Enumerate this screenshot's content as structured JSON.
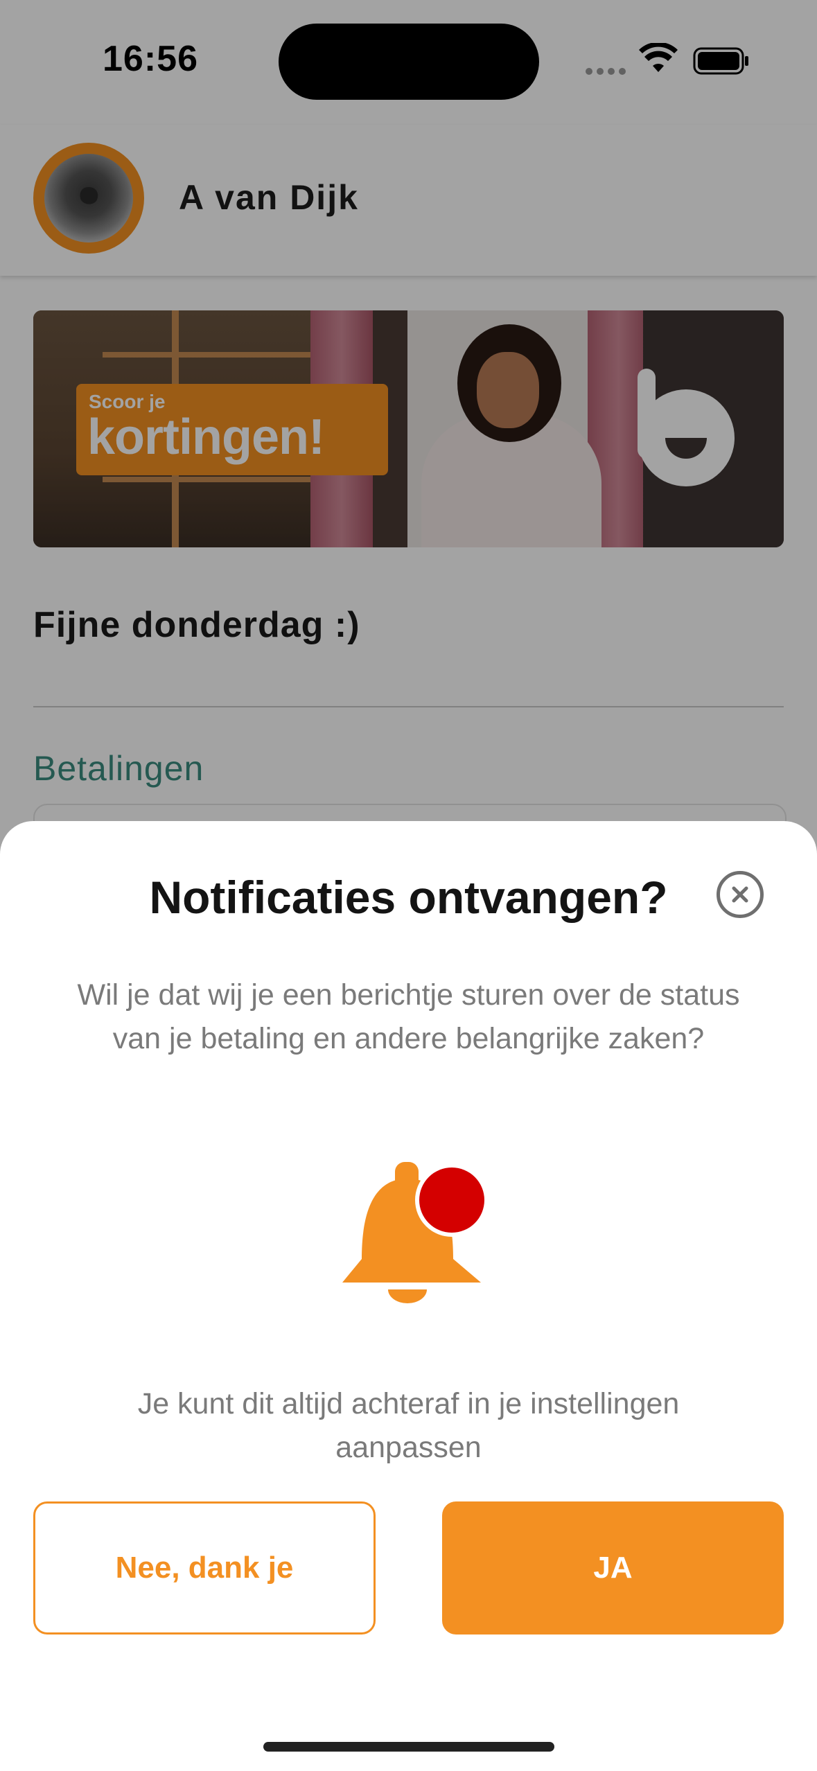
{
  "status_bar": {
    "time": "16:56"
  },
  "header": {
    "user_name": "A van Dijk"
  },
  "banner": {
    "tag_small": "Scoor je",
    "tag_big": "kortingen!"
  },
  "greeting": "Fijne donderdag :)",
  "section": {
    "title": "Betalingen"
  },
  "sheet": {
    "title": "Notificaties ontvangen?",
    "body": "Wil je dat wij je een berichtje sturen over de status van je betaling en andere belangrijke zaken?",
    "hint": "Je kunt dit altijd achteraf in je instellingen aanpassen",
    "decline_label": "Nee, dank je",
    "accept_label": "JA"
  },
  "colors": {
    "accent": "#f39022",
    "section_title": "#3a8b7f",
    "badge": "#d40000"
  },
  "icons": [
    "close-icon",
    "bell-icon",
    "wifi-icon",
    "battery-icon",
    "brand-logo-icon"
  ]
}
